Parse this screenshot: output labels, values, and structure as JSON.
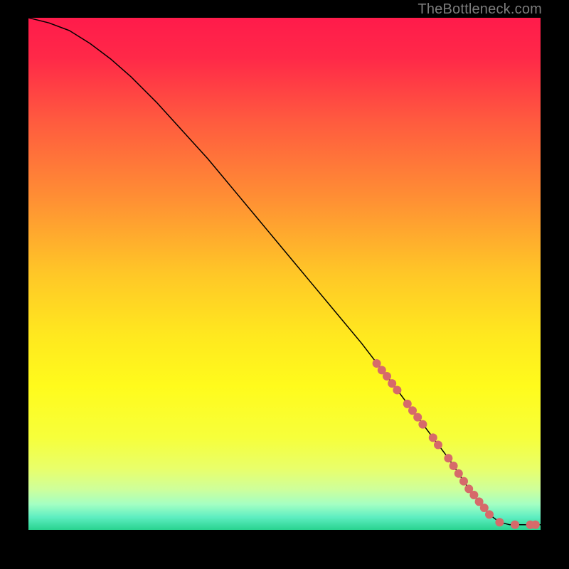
{
  "watermark": "TheBottleneck.com",
  "chart_data": {
    "type": "line",
    "title": "",
    "xlabel": "",
    "ylabel": "",
    "xlim": [
      0,
      100
    ],
    "ylim": [
      0,
      100
    ],
    "grid": false,
    "axes_visible": false,
    "legend": false,
    "background": {
      "type": "vertical-gradient",
      "stops": [
        {
          "offset": 0.0,
          "color": "#ff1b4b"
        },
        {
          "offset": 0.08,
          "color": "#ff2948"
        },
        {
          "offset": 0.2,
          "color": "#ff5a3f"
        },
        {
          "offset": 0.35,
          "color": "#ff8e34"
        },
        {
          "offset": 0.5,
          "color": "#ffc727"
        },
        {
          "offset": 0.62,
          "color": "#ffe81f"
        },
        {
          "offset": 0.72,
          "color": "#fffb1c"
        },
        {
          "offset": 0.82,
          "color": "#f6ff3b"
        },
        {
          "offset": 0.88,
          "color": "#e9ff6a"
        },
        {
          "offset": 0.92,
          "color": "#cfff9a"
        },
        {
          "offset": 0.95,
          "color": "#a4ffc3"
        },
        {
          "offset": 0.975,
          "color": "#5eeec1"
        },
        {
          "offset": 1.0,
          "color": "#29d38f"
        }
      ]
    },
    "series": [
      {
        "name": "bottleneck-curve",
        "type": "line",
        "color": "#000000",
        "width": 1.5,
        "x": [
          0,
          4,
          8,
          12,
          16,
          20,
          25,
          30,
          35,
          40,
          45,
          50,
          55,
          60,
          65,
          70,
          73,
          76,
          79,
          82,
          84,
          86,
          88,
          90,
          92,
          94,
          96,
          98,
          100
        ],
        "y": [
          100,
          99,
          97.5,
          95,
          92,
          88.5,
          83.5,
          78,
          72.5,
          66.5,
          60.5,
          54.5,
          48.5,
          42.5,
          36.5,
          30.0,
          26.0,
          22.0,
          18.0,
          14.0,
          11.0,
          8.0,
          5.5,
          3.0,
          1.5,
          1.0,
          1.0,
          1.0,
          1.0
        ]
      },
      {
        "name": "highlight-markers",
        "type": "scatter",
        "color": "#d66a6a",
        "radius": 6,
        "x": [
          68,
          69,
          70,
          71,
          72,
          74,
          75,
          76,
          77,
          79,
          80,
          82,
          83,
          84,
          85,
          86,
          87,
          88,
          89,
          90,
          92,
          95,
          98,
          99
        ],
        "y": [
          32.5,
          31.2,
          30.0,
          28.6,
          27.3,
          24.6,
          23.3,
          22.0,
          20.6,
          18.0,
          16.6,
          14.0,
          12.5,
          11.0,
          9.5,
          8.0,
          6.8,
          5.5,
          4.3,
          3.0,
          1.5,
          1.0,
          1.0,
          1.0
        ]
      }
    ]
  }
}
